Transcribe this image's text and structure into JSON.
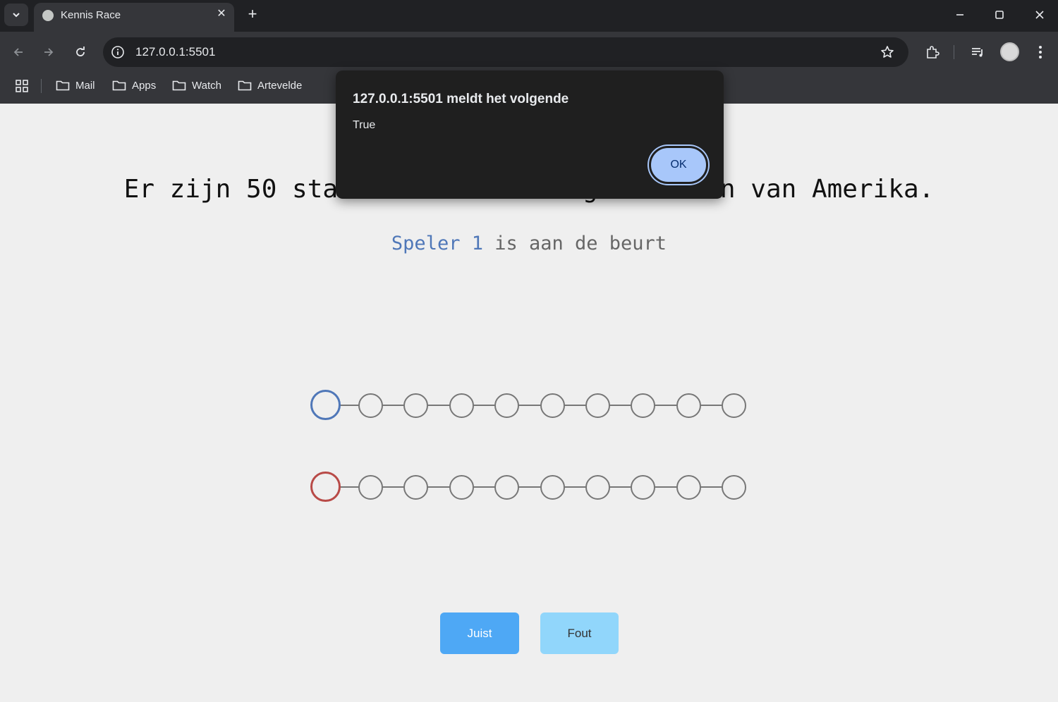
{
  "browser": {
    "tab_title": "Kennis Race",
    "url": "127.0.0.1:5501",
    "bookmarks": [
      "Mail",
      "Apps",
      "Watch",
      "Artevelde"
    ]
  },
  "page": {
    "question": "Er zijn 50 staten in de Verenigde Staten van Amerika.",
    "turn_player": "Speler 1",
    "turn_suffix": " is aan de beurt",
    "player_colors": {
      "player1": "#4f77b8",
      "player2": "#b84a47"
    },
    "track_positions": 10,
    "buttons": {
      "correct": "Juist",
      "wrong": "Fout"
    }
  },
  "dialog": {
    "title": "127.0.0.1:5501 meldt het volgende",
    "message": "True",
    "ok_label": "OK"
  }
}
